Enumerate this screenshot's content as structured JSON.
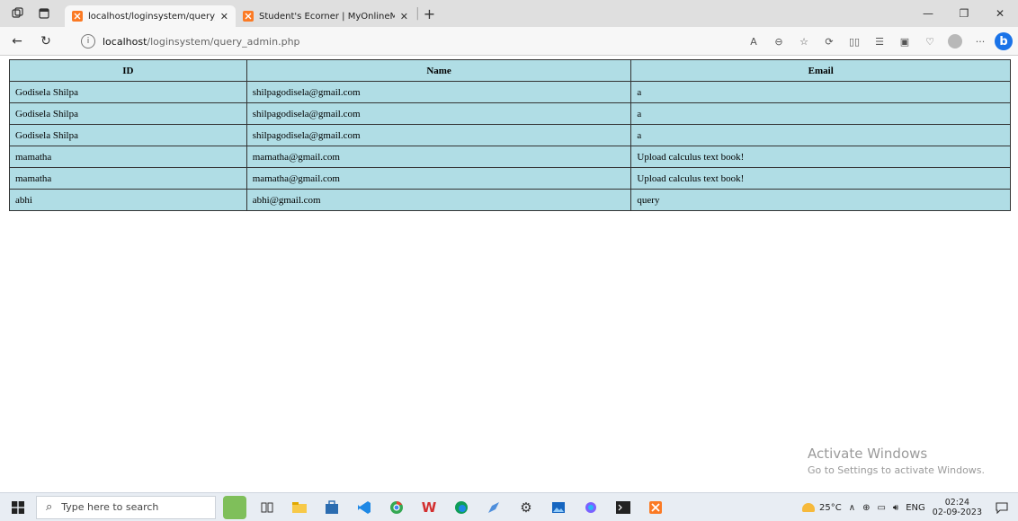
{
  "browser": {
    "tabs": [
      {
        "title": "localhost/loginsystem/query_adm"
      },
      {
        "title": "Student's Ecorner | MyOnlineMe"
      }
    ],
    "new_tab": "+",
    "url_host": "localhost",
    "url_path": "/loginsystem/query_admin.php"
  },
  "table": {
    "headers": [
      "ID",
      "Name",
      "Email"
    ],
    "rows": [
      [
        "Godisela Shilpa",
        "shilpagodisela@gmail.com",
        "a"
      ],
      [
        "Godisela Shilpa",
        "shilpagodisela@gmail.com",
        "a"
      ],
      [
        "Godisela Shilpa",
        "shilpagodisela@gmail.com",
        "a"
      ],
      [
        "mamatha",
        "mamatha@gmail.com",
        "Upload calculus text book!"
      ],
      [
        "mamatha",
        "mamatha@gmail.com",
        "Upload calculus text book!"
      ],
      [
        "abhi",
        "abhi@gmail.com",
        "query"
      ]
    ]
  },
  "watermark": {
    "line1": "Activate Windows",
    "line2": "Go to Settings to activate Windows."
  },
  "taskbar": {
    "search_placeholder": "Type here to search",
    "temperature": "25°C",
    "language": "ENG",
    "time": "02:24",
    "date": "02-09-2023"
  },
  "colors": {
    "table_cell_bg": "#b0dde5",
    "tab_favicon": "#fb7a24",
    "bing_blue": "#1a73e8"
  }
}
